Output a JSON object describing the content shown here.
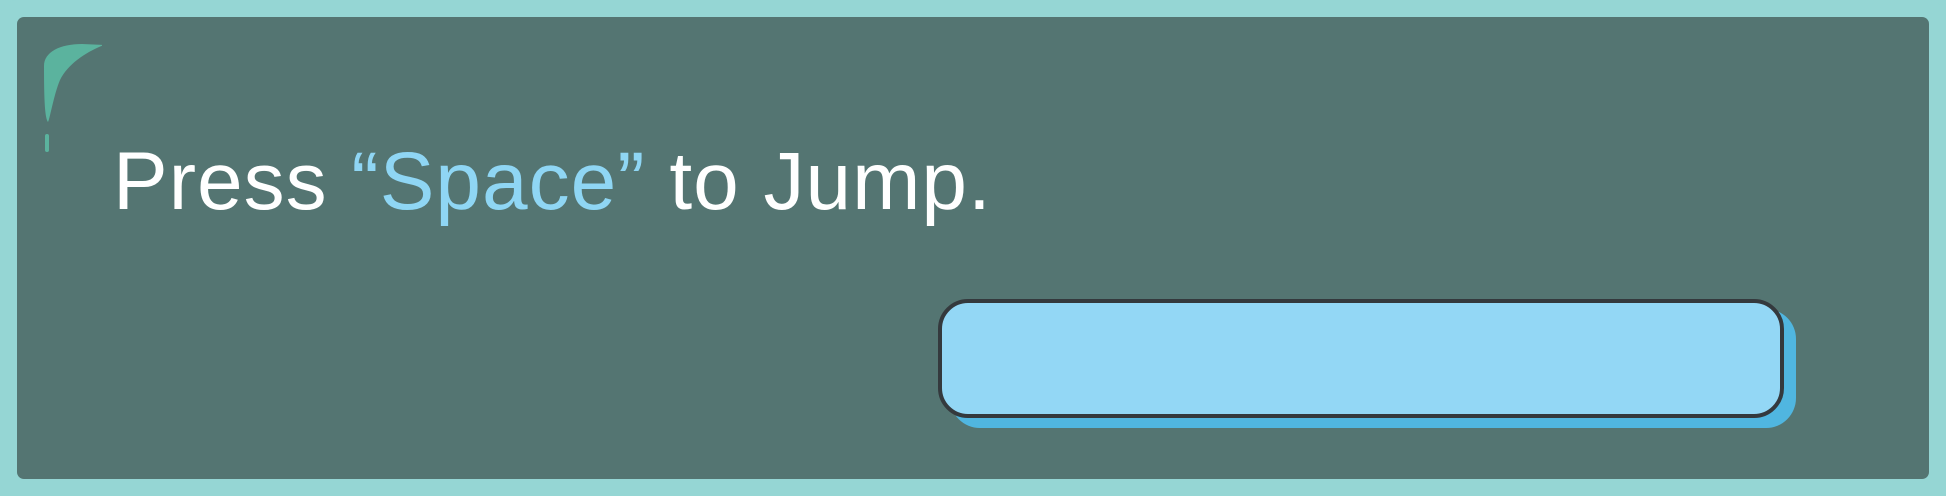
{
  "instruction": {
    "before": "Press ",
    "open_quote": "“",
    "key": "Space",
    "close_quote": "”",
    "after": " to Jump."
  },
  "jump_bar": {
    "label": ""
  },
  "colors": {
    "frame": "#95d6d4",
    "panel": "#547572",
    "text": "#ffffff",
    "key_highlight": "#8fd6f4",
    "bar_fill": "#93d7f5",
    "bar_shadow": "#50b6e0",
    "bar_outline": "#34393d",
    "corner_accent": "#5bb39e"
  }
}
